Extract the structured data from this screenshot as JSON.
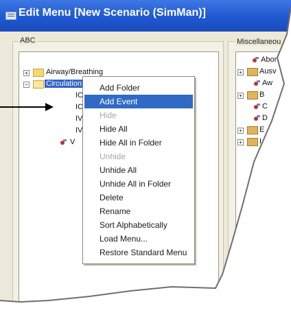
{
  "window": {
    "title": "Edit Menu  [New Scenario (SimMan)]"
  },
  "left_panel": {
    "title": "ABC",
    "tree": [
      {
        "label": "Airway/Breathing",
        "type": "folder",
        "expander": "+"
      },
      {
        "label": "Circulation",
        "type": "folder",
        "expander": "−",
        "selected": true
      },
      {
        "label": "IC",
        "type": "event"
      },
      {
        "label": "IC",
        "type": "event"
      },
      {
        "label": "IV",
        "type": "event"
      },
      {
        "label": "IV",
        "type": "event"
      },
      {
        "label": "V",
        "type": "event"
      }
    ]
  },
  "right_panel": {
    "title": "Miscellaneou",
    "tree": [
      {
        "label": "Abort",
        "type": "event"
      },
      {
        "label": "Ausv",
        "type": "folder",
        "expander": "+"
      },
      {
        "label": "Aw",
        "type": "event"
      },
      {
        "label": "B",
        "type": "folder",
        "expander": "+"
      },
      {
        "label": "C",
        "type": "event"
      },
      {
        "label": "D",
        "type": "event"
      },
      {
        "label": "E",
        "type": "folder",
        "expander": "+"
      },
      {
        "label": "I",
        "type": "folder",
        "expander": "+"
      }
    ]
  },
  "context_menu": {
    "items": [
      {
        "label": "Add Folder",
        "state": "normal"
      },
      {
        "label": "Add Event",
        "state": "highlighted"
      },
      {
        "label": "Hide",
        "state": "disabled"
      },
      {
        "label": "Hide All",
        "state": "normal"
      },
      {
        "label": "Hide All in Folder",
        "state": "normal"
      },
      {
        "label": "Unhide",
        "state": "disabled"
      },
      {
        "label": "Unhide All",
        "state": "normal"
      },
      {
        "label": "Unhide All in Folder",
        "state": "normal"
      },
      {
        "label": "Delete",
        "state": "normal"
      },
      {
        "label": "Rename",
        "state": "normal"
      },
      {
        "label": "Sort Alphabetically",
        "state": "normal"
      },
      {
        "label": "Load Menu...",
        "state": "normal"
      },
      {
        "label": "Restore Standard Menu",
        "state": "normal"
      }
    ]
  },
  "colors": {
    "titlebar": "#2a62d6",
    "highlight": "#316ac5",
    "selection": "#3165c3",
    "window_bg": "#ece9d8"
  }
}
